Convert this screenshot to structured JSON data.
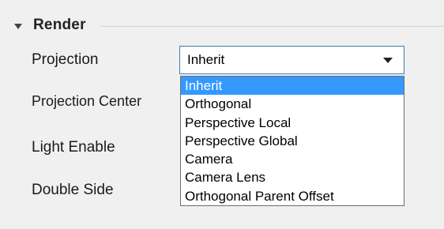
{
  "section": {
    "title": "Render"
  },
  "properties": {
    "projection_label": "Projection",
    "projection_center_label": "Projection Center",
    "light_enable_label": "Light Enable",
    "double_side_label": "Double Side"
  },
  "combo": {
    "value": "Inherit"
  },
  "dropdown": {
    "options": [
      "Inherit",
      "Orthogonal",
      "Perspective Local",
      "Perspective Global",
      "Camera",
      "Camera Lens",
      "Orthogonal Parent Offset"
    ],
    "selected_index": 0
  },
  "colors": {
    "selection": "#3399ff",
    "combo_border": "#3c7fb1",
    "panel_bg": "#f0f0f0"
  }
}
